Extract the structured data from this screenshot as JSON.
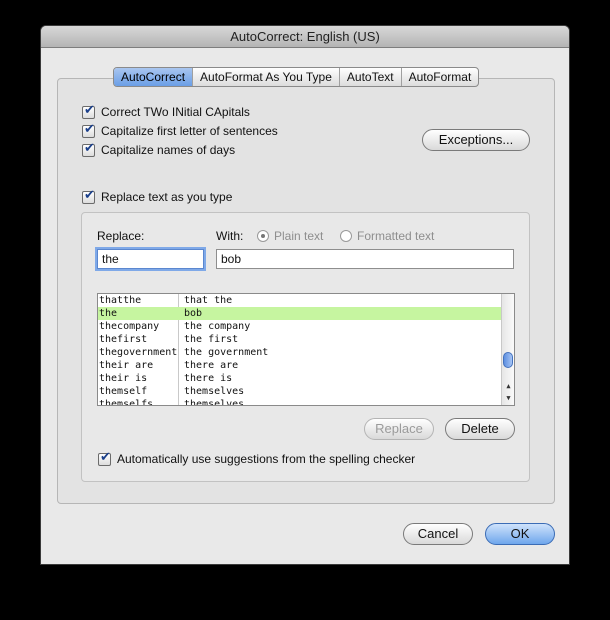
{
  "window": {
    "title": "AutoCorrect: English (US)"
  },
  "tabs": [
    {
      "label": "AutoCorrect",
      "active": true
    },
    {
      "label": "AutoFormat As You Type",
      "active": false
    },
    {
      "label": "AutoText",
      "active": false
    },
    {
      "label": "AutoFormat",
      "active": false
    }
  ],
  "options": {
    "correct_two_initial": {
      "label": "Correct TWo INitial CApitals",
      "checked": true
    },
    "capitalize_first": {
      "label": "Capitalize first letter of sentences",
      "checked": true
    },
    "capitalize_days": {
      "label": "Capitalize names of days",
      "checked": true
    },
    "replace_as_type": {
      "label": "Replace text as you type",
      "checked": true
    },
    "auto_suggestions": {
      "label": "Automatically use suggestions from the spelling checker",
      "checked": true
    }
  },
  "exceptions_button": "Exceptions...",
  "replace": {
    "label": "Replace:",
    "value": "the",
    "with_label": "With:",
    "with_value": "bob",
    "plain_text_label": "Plain text",
    "formatted_text_label": "Formatted text",
    "selected_format": "Plain text"
  },
  "entries": [
    {
      "replace": "thatthe",
      "with": "that the"
    },
    {
      "replace": "the",
      "with": "bob",
      "selected": true
    },
    {
      "replace": "thecompany",
      "with": "the company"
    },
    {
      "replace": "thefirst",
      "with": "the first"
    },
    {
      "replace": "thegovernment",
      "with": "the government"
    },
    {
      "replace": "their are",
      "with": "there are"
    },
    {
      "replace": "their is",
      "with": "there is"
    },
    {
      "replace": "themself",
      "with": "themselves"
    },
    {
      "replace": "themselfs",
      "with": "themselves"
    }
  ],
  "buttons": {
    "replace": "Replace",
    "delete": "Delete",
    "cancel": "Cancel",
    "ok": "OK"
  },
  "colors": {
    "selected_row": "#c6f5a0",
    "accent": "#6a9ee6"
  }
}
